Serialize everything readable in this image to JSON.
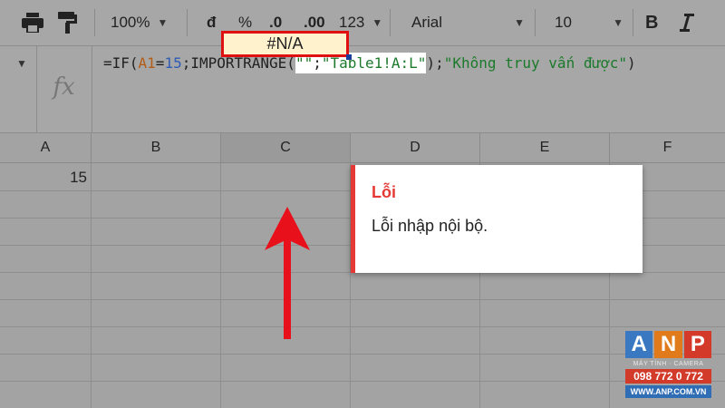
{
  "toolbar": {
    "zoom": "100%",
    "currency": "đ",
    "percent": "%",
    "decrease_decimal": ".0",
    "increase_decimal": ".00",
    "more_formats": "123",
    "font": "Arial",
    "font_size": "10",
    "bold": "B"
  },
  "formula_bar": {
    "fx": "fx",
    "formula": {
      "p1": "=IF(",
      "ref": "A1",
      "p2": "=",
      "num": "15",
      "p3": ";IMPORTRANGE(",
      "arg1": "\"\"",
      "sep": ";",
      "arg2": "\"Table1!A:L\"",
      "p4": ");",
      "arg3": "\"Không truy vấn được\"",
      "p5": ")"
    }
  },
  "columns": [
    "A",
    "B",
    "C",
    "D",
    "E",
    "F"
  ],
  "cells": {
    "a1": "15",
    "c1": "#N/A"
  },
  "tooltip": {
    "title": "Lỗi",
    "message": "Lỗi nhập nội bộ."
  },
  "logo": {
    "letters": [
      "A",
      "N",
      "P"
    ],
    "subtitle": "MÁY TÍNH · CAMERA",
    "phone": "098 772 0 772",
    "website": "WWW.ANP.COM.VN"
  },
  "colors": {
    "error_red": "#e53935",
    "cell_highlight": "#fff2cc",
    "arrow_red": "#e8101a"
  }
}
